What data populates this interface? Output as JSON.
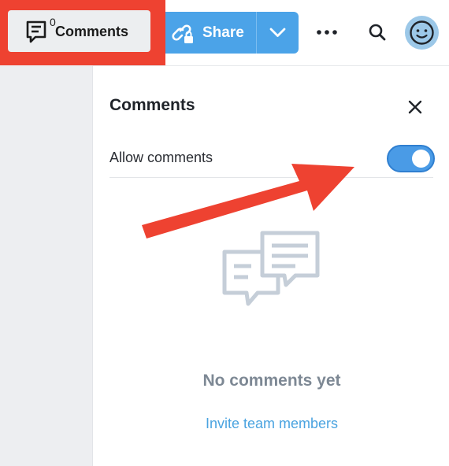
{
  "toolbar": {
    "comments_label": "Comments",
    "comments_count": "0",
    "share_label": "Share",
    "icons": {
      "comments": "comment-icon",
      "share": "share-link-lock-icon",
      "share_menu": "chevron-down-icon",
      "more": "more-horizontal-icon",
      "search": "search-icon",
      "avatar": "avatar-face-icon"
    }
  },
  "panel": {
    "title": "Comments",
    "allow_comments_label": "Allow comments",
    "allow_comments_on": true,
    "empty_text": "No comments yet",
    "invite_link": "Invite team members"
  },
  "colors": {
    "highlight": "#ee4231",
    "accent": "#4ba3e8",
    "link": "#4aa3e0",
    "muted_text": "#7d8894"
  }
}
